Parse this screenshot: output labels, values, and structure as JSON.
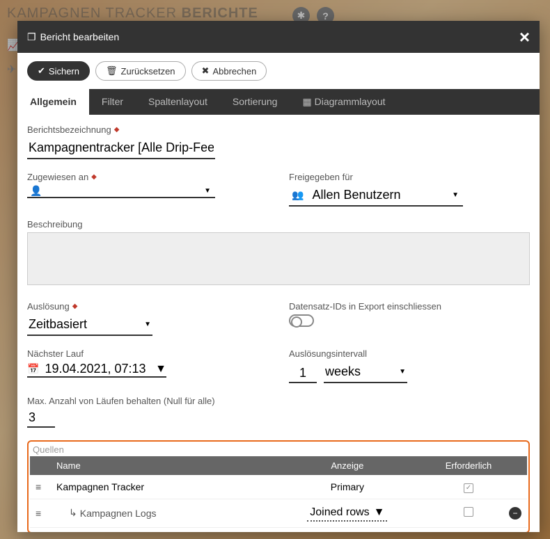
{
  "bg": {
    "title_pre": "KAMPAGNEN TRACKER ",
    "title_bold": "BERICHTE"
  },
  "modal": {
    "title": "Bericht bearbeiten",
    "buttons": {
      "save": "Sichern",
      "reset": "Zurücksetzen",
      "cancel": "Abbrechen"
    },
    "tabs": [
      "Allgemein",
      "Filter",
      "Spaltenlayout",
      "Sortierung",
      "Diagrammlayout"
    ]
  },
  "form": {
    "name_label": "Berichtsbezeichnung",
    "name_value": "Kampagnentracker [Alle Drip-Feeds S",
    "assigned_label": "Zugewiesen an",
    "assigned_value": "",
    "shared_label": "Freigegeben für",
    "shared_value": "Allen Benutzern",
    "desc_label": "Beschreibung",
    "desc_value": "",
    "trigger_label": "Auslösung",
    "trigger_value": "Zeitbasiert",
    "include_ids_label": "Datensatz-IDs in Export einschliessen",
    "next_run_label": "Nächster Lauf",
    "next_run_value": "19.04.2021, 07:13",
    "interval_label": "Auslösungsintervall",
    "interval_num": "1",
    "interval_unit": "weeks",
    "max_runs_label": "Max. Anzahl von Läufen behalten (Null für alle)",
    "max_runs_value": "3"
  },
  "sources": {
    "title": "Quellen",
    "cols": {
      "name": "Name",
      "display": "Anzeige",
      "required": "Erforderlich"
    },
    "rows": [
      {
        "name": "Kampagnen Tracker",
        "display": "Primary",
        "required": true,
        "indent": false
      },
      {
        "name": "Kampagnen Logs",
        "display": "Joined rows",
        "required": false,
        "indent": true
      }
    ]
  }
}
